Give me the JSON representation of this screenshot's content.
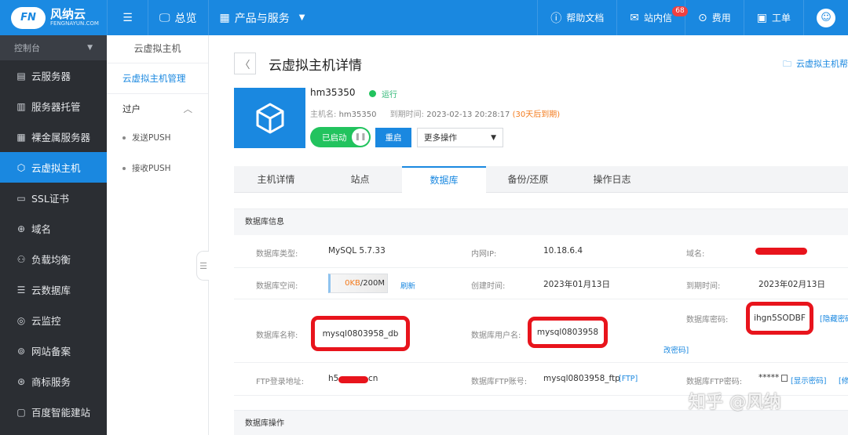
{
  "topbar": {
    "logo_cn": "风纳云",
    "logo_en": "FENGNAYUN.COM",
    "overview": "总览",
    "products": "产品与服务",
    "help_docs": "帮助文档",
    "inbox": "站内信",
    "inbox_count": "68",
    "billing": "费用",
    "tickets": "工单"
  },
  "sidebar": {
    "header": "控制台",
    "items": [
      {
        "label": "云服务器",
        "icon": "server-icon"
      },
      {
        "label": "服务器托管",
        "icon": "hosting-icon"
      },
      {
        "label": "裸金属服务器",
        "icon": "bare-metal-icon"
      },
      {
        "label": "云虚拟主机",
        "icon": "cube-icon"
      },
      {
        "label": "SSL证书",
        "icon": "certificate-icon"
      },
      {
        "label": "域名",
        "icon": "globe-icon"
      },
      {
        "label": "负载均衡",
        "icon": "load-balance-icon"
      },
      {
        "label": "云数据库",
        "icon": "database-icon"
      },
      {
        "label": "云监控",
        "icon": "monitor-icon"
      },
      {
        "label": "网站备案",
        "icon": "record-icon"
      },
      {
        "label": "商标服务",
        "icon": "trademark-icon"
      },
      {
        "label": "百度智能建站",
        "icon": "site-builder-icon"
      }
    ]
  },
  "subnav": {
    "title": "云虚拟主机",
    "manage": "云虚拟主机管理",
    "group": "过户",
    "send_push": "发送PUSH",
    "receive_push": "接收PUSH"
  },
  "page": {
    "title": "云虚拟主机详情",
    "help_link": "云虚拟主机帮"
  },
  "host": {
    "name": "hm35350",
    "status": "运行",
    "hostname_label": "主机名:",
    "hostname": "hm35350",
    "expire_label": "到期时间:",
    "expire": "2023-02-13 20:28:17",
    "expire_note": "(30天后到期)",
    "toggle_label": "已启动",
    "restart": "重启",
    "more_ops": "更多操作"
  },
  "tabs": [
    "主机详情",
    "站点",
    "数据库",
    "备份/还原",
    "操作日志"
  ],
  "db": {
    "section_title": "数据库信息",
    "type_label": "数据库类型:",
    "type": "MySQL 5.7.33",
    "intranet_label": "内网IP:",
    "intranet": "10.18.6.4",
    "domain_label": "域名:",
    "space_label": "数据库空间:",
    "space_used": "0KB",
    "space_total": "/200M",
    "refresh": "刷新",
    "created_label": "创建时间:",
    "created": "2023年01月13日",
    "expire_label": "到期时间:",
    "expire": "2023年02月13日",
    "password_label": "数据库密码:",
    "password": "ihgn5SODBF",
    "hide_password": "[隐藏密码",
    "name_label": "数据库名称:",
    "name": "mysql0803958_db",
    "user_label": "数据库用户名:",
    "user": "mysql0803958",
    "change_password": "改密码]",
    "ftp_addr_label": "FTP登录地址:",
    "ftp_addr_prefix": "h5",
    "ftp_addr_suffix": "cn",
    "ftp_account_label": "数据库FTP账号:",
    "ftp_account": "mysql0803958_ftp",
    "ftp_tag": "[FTP]",
    "ftp_pwd_label": "数据库FTP密码:",
    "ftp_pwd": "*****",
    "show_password": "[显示密码]",
    "modify": "[修改",
    "ops_title": "数据库操作"
  },
  "watermark": "知乎 @风纳",
  "colors": {
    "primary": "#1a88e0",
    "sidebar": "#2b2e33",
    "running": "#22c35e",
    "warning": "#f37b1d",
    "annotation": "#e8141c"
  }
}
